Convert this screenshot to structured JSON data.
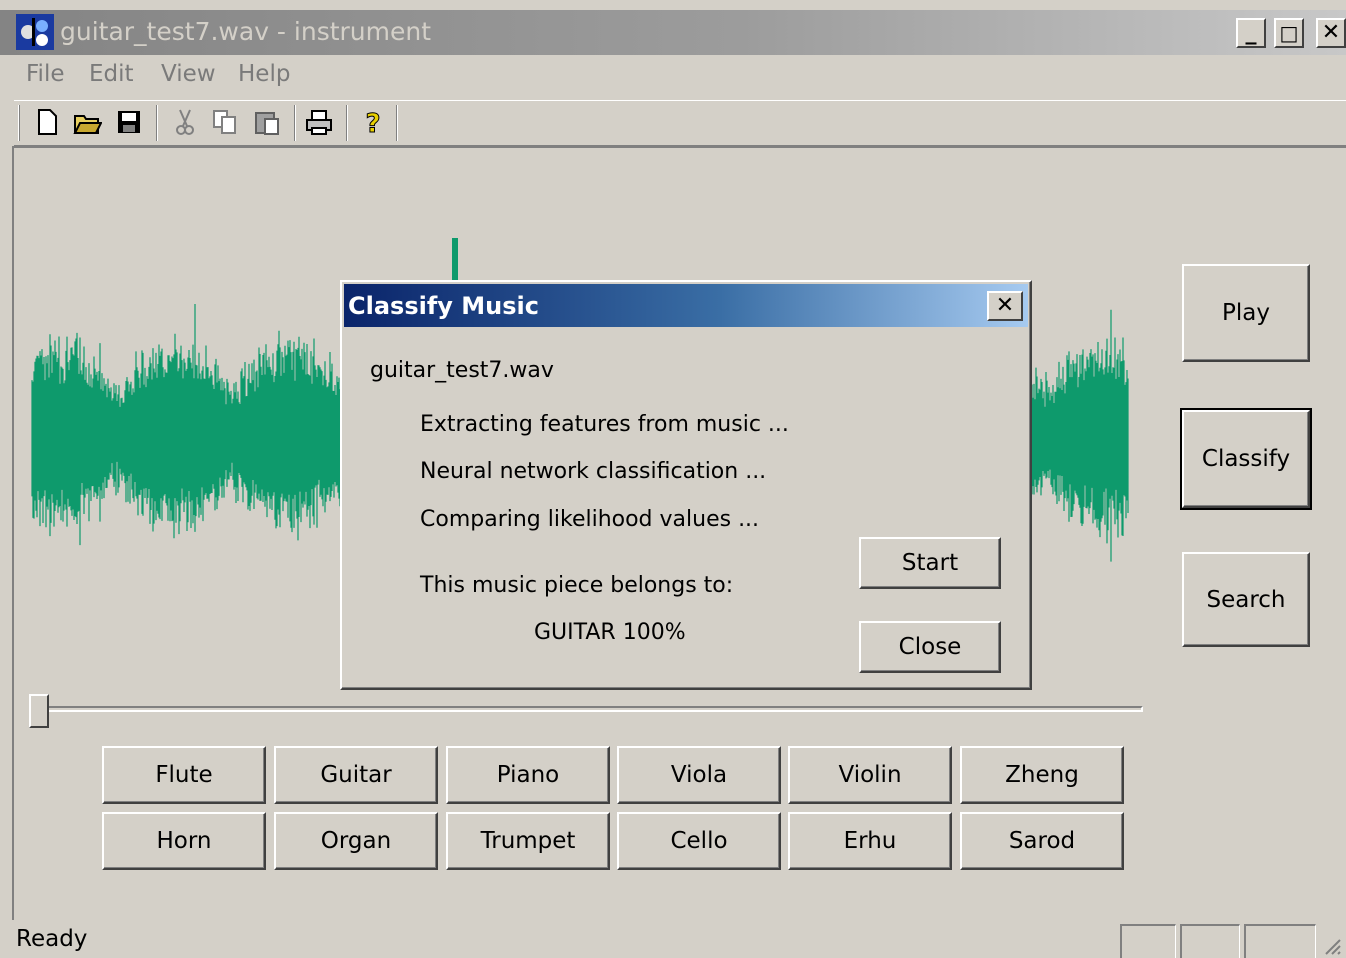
{
  "window": {
    "title": "guitar_test7.wav - instrument"
  },
  "caption_buttons": {
    "minimize": "_",
    "maximize": "□",
    "close": "✕"
  },
  "menu": [
    "File",
    "Edit",
    "View",
    "Help"
  ],
  "toolbar": [
    "new-icon",
    "open-icon",
    "save-icon",
    "cut-icon",
    "copy-icon",
    "paste-icon",
    "print-icon",
    "help-icon"
  ],
  "side_buttons": {
    "play": "Play",
    "classify": "Classify",
    "search": "Search"
  },
  "instruments": {
    "row1": [
      "Flute",
      "Guitar",
      "Piano",
      "Viola",
      "Violin",
      "Zheng"
    ],
    "row2": [
      "Horn",
      "Organ",
      "Trumpet",
      "Cello",
      "Erhu",
      "Sarod"
    ]
  },
  "dialog": {
    "title": "Classify Music",
    "close": "✕",
    "filename": "guitar_test7.wav",
    "steps": [
      "Extracting features from music ...",
      "Neural network classification ...",
      "Comparing likelihood values ..."
    ],
    "result_label": "This music piece belongs to:",
    "result_value": "GUITAR 100%",
    "start_button": "Start",
    "close_button": "Close"
  },
  "status": {
    "text": "Ready"
  },
  "colors": {
    "waveform": "#0e9a6c",
    "dialog_title_start": "#0a246a",
    "dialog_title_end": "#a6caf0"
  }
}
